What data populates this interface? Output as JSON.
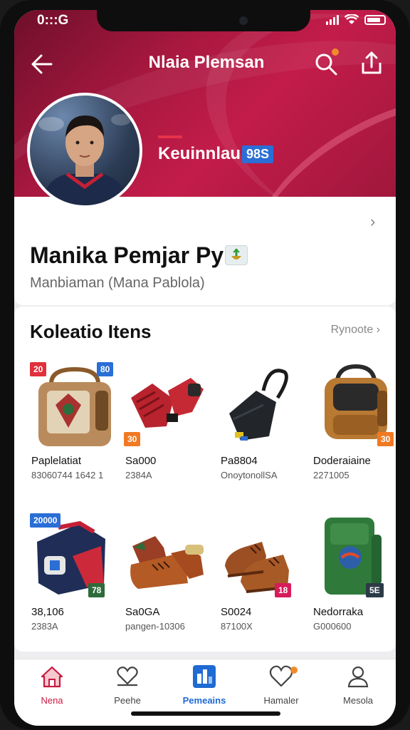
{
  "status_bar": {
    "time": "0:::G"
  },
  "header": {
    "title": "Nlaia Plemsan"
  },
  "hero": {
    "name": "Keuinnlau",
    "level": "98S"
  },
  "profile": {
    "name": "Manika Pemjar Pyr",
    "subtitle": "Manbiaman (Mana Pablola)"
  },
  "collection": {
    "title": "Koleatio Itens",
    "see_more": "Rynoote",
    "items": [
      {
        "name": "Paplelatiat",
        "meta": "83060744 1642 1",
        "tag": "20",
        "tag2": "80",
        "icon": "backpack-icon"
      },
      {
        "name": "Sa000",
        "meta": "2384A",
        "tag": "30",
        "icon": "gloves-icon"
      },
      {
        "name": "Pa8804",
        "meta": "OnoytonollSA",
        "icon": "shoulder-bag-icon"
      },
      {
        "name": "Doderaiaine",
        "meta": "2271005",
        "tag": "30",
        "icon": "backpack-icon"
      },
      {
        "name": "38,106",
        "meta": "2383A",
        "tag": "20000",
        "tag2": "78",
        "icon": "duffel-bag-icon"
      },
      {
        "name": "Sa0GA",
        "meta": "pangen-10306",
        "icon": "boots-icon"
      },
      {
        "name": "S0024",
        "meta": "87100X",
        "tag": "18",
        "icon": "shoes-icon"
      },
      {
        "name": "Nedorraka",
        "meta": "G000600",
        "tag": "5E",
        "icon": "green-backpack-icon"
      }
    ]
  },
  "nav": [
    {
      "label": "Nena",
      "icon": "home-icon",
      "active": false
    },
    {
      "label": "Peehe",
      "icon": "heart-hand-icon",
      "active": false
    },
    {
      "label": "Pemeains",
      "icon": "collection-icon",
      "active": true
    },
    {
      "label": "Hamaler",
      "icon": "heart-icon",
      "active": false
    },
    {
      "label": "Mesola",
      "icon": "profile-icon",
      "active": false
    }
  ],
  "colors": {
    "brand": "#b8193f",
    "active_nav": "#1f6ad3",
    "tag_red": "#e0303b",
    "tag_blue": "#2a6ed6",
    "tag_orange": "#f07a23",
    "tag_pink": "#d61c59",
    "tag_dark": "#2c3a46"
  }
}
